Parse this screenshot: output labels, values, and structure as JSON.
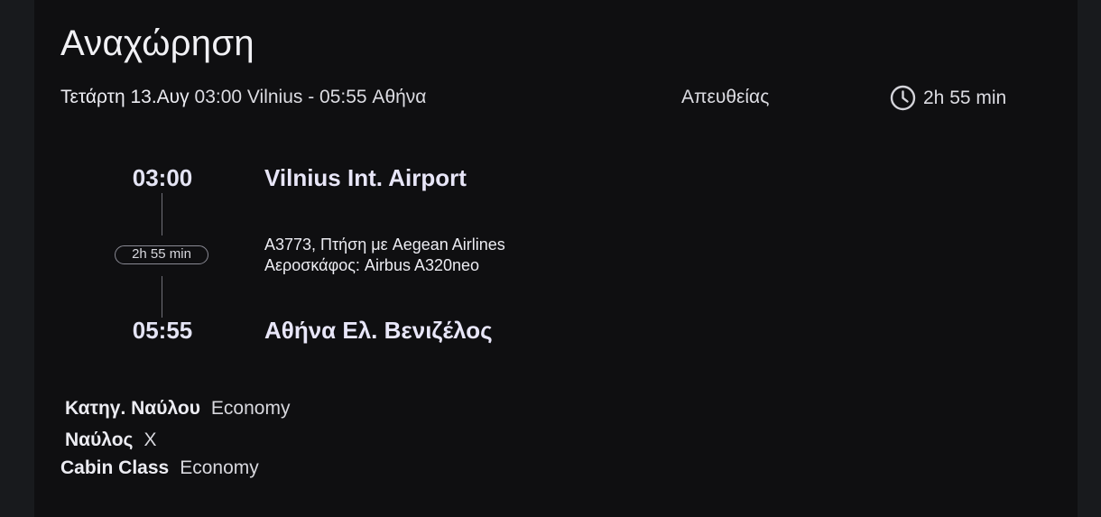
{
  "header": {
    "title": "Αναχώρηση",
    "date": "Τετάρτη 13.Αυγ",
    "route_text": "03:00 Vilnius - 05:55 Αθήνα",
    "stop_type": "Απευθείας",
    "duration": "2h 55 min",
    "duration_icon": "clock-icon"
  },
  "timeline": {
    "departure_time": "03:00",
    "departure_airport": "Vilnius Int. Airport",
    "duration": "2h 55 min",
    "flight_line": "A3773, Πτήση με Aegean Airlines",
    "aircraft_line": "Αεροσκάφος: Airbus A320neo",
    "arrival_time": "05:55",
    "arrival_airport": "Αθήνα Ελ. Βενιζέλος"
  },
  "details": {
    "fare_category_label": "Κατηγ. Ναύλου",
    "fare_category_value": "Economy",
    "fare_label": "Ναύλος",
    "fare_value": "X",
    "cabin_class_label": "Cabin Class",
    "cabin_class_value": "Economy"
  },
  "colors": {
    "background": "#0f0f11",
    "text": "#e9e9ee",
    "accent_text": "#e4e4f4"
  }
}
